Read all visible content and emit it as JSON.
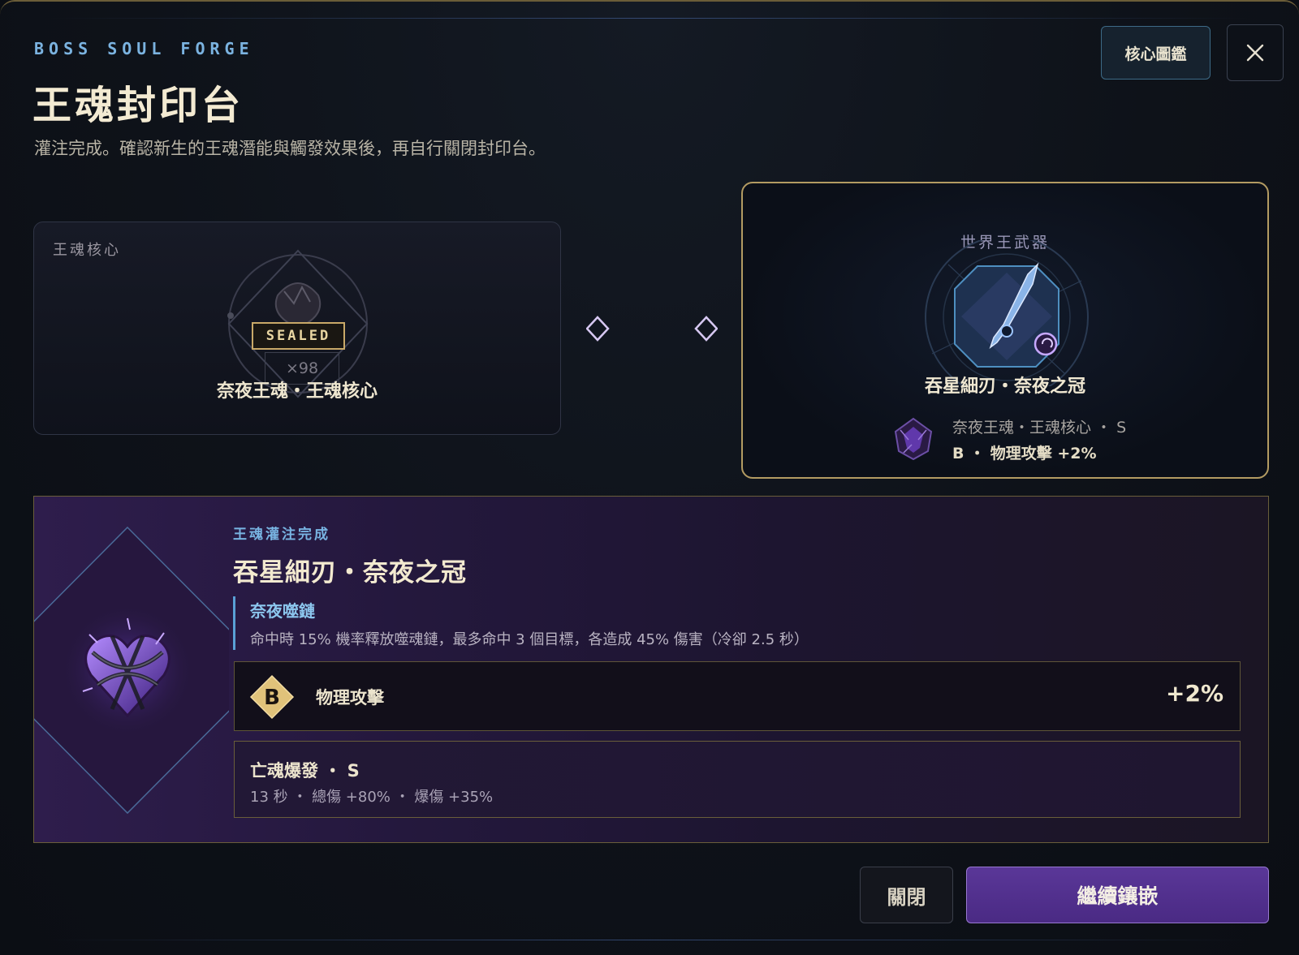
{
  "header": {
    "eyebrow": "BOSS SOUL FORGE",
    "title": "王魂封印台",
    "subtitle": "灌注完成。確認新生的王魂潛能與觸發效果後，再自行關閉封印台。",
    "codex_label": "核心圖鑑",
    "close_icon": "close-icon"
  },
  "core_slot": {
    "label": "王魂核心",
    "status_badge": "SEALED",
    "quantity": "×98",
    "name": "奈夜王魂・王魂核心"
  },
  "weapon_slot": {
    "label": "世界王武器",
    "name": "吞星細刃・奈夜之冠",
    "socket_line": "奈夜王魂・王魂核心 ・ S",
    "stat_line": "B ・ 物理攻擊 +2%"
  },
  "infusion": {
    "eyebrow": "王魂灌注完成",
    "name": "吞星細刃・奈夜之冠",
    "skill_name": "奈夜噬鏈",
    "skill_desc": "命中時 15% 機率釋放噬魂鏈，最多命中 3 個目標，各造成 45% 傷害（冷卻 2.5 秒）",
    "stat": {
      "grade": "B",
      "label": "物理攻擊",
      "value": "+2%"
    },
    "trigger": {
      "title": "亡魂爆發 ・ S",
      "desc": "13 秒 ・ 總傷 +80% ・ 爆傷 +35%"
    }
  },
  "footer": {
    "close_label": "關閉",
    "continue_label": "繼續鑲嵌"
  },
  "colors": {
    "accent_gold": "#c9a968",
    "accent_blue": "#78b4e2",
    "accent_purple": "#5a3798"
  }
}
